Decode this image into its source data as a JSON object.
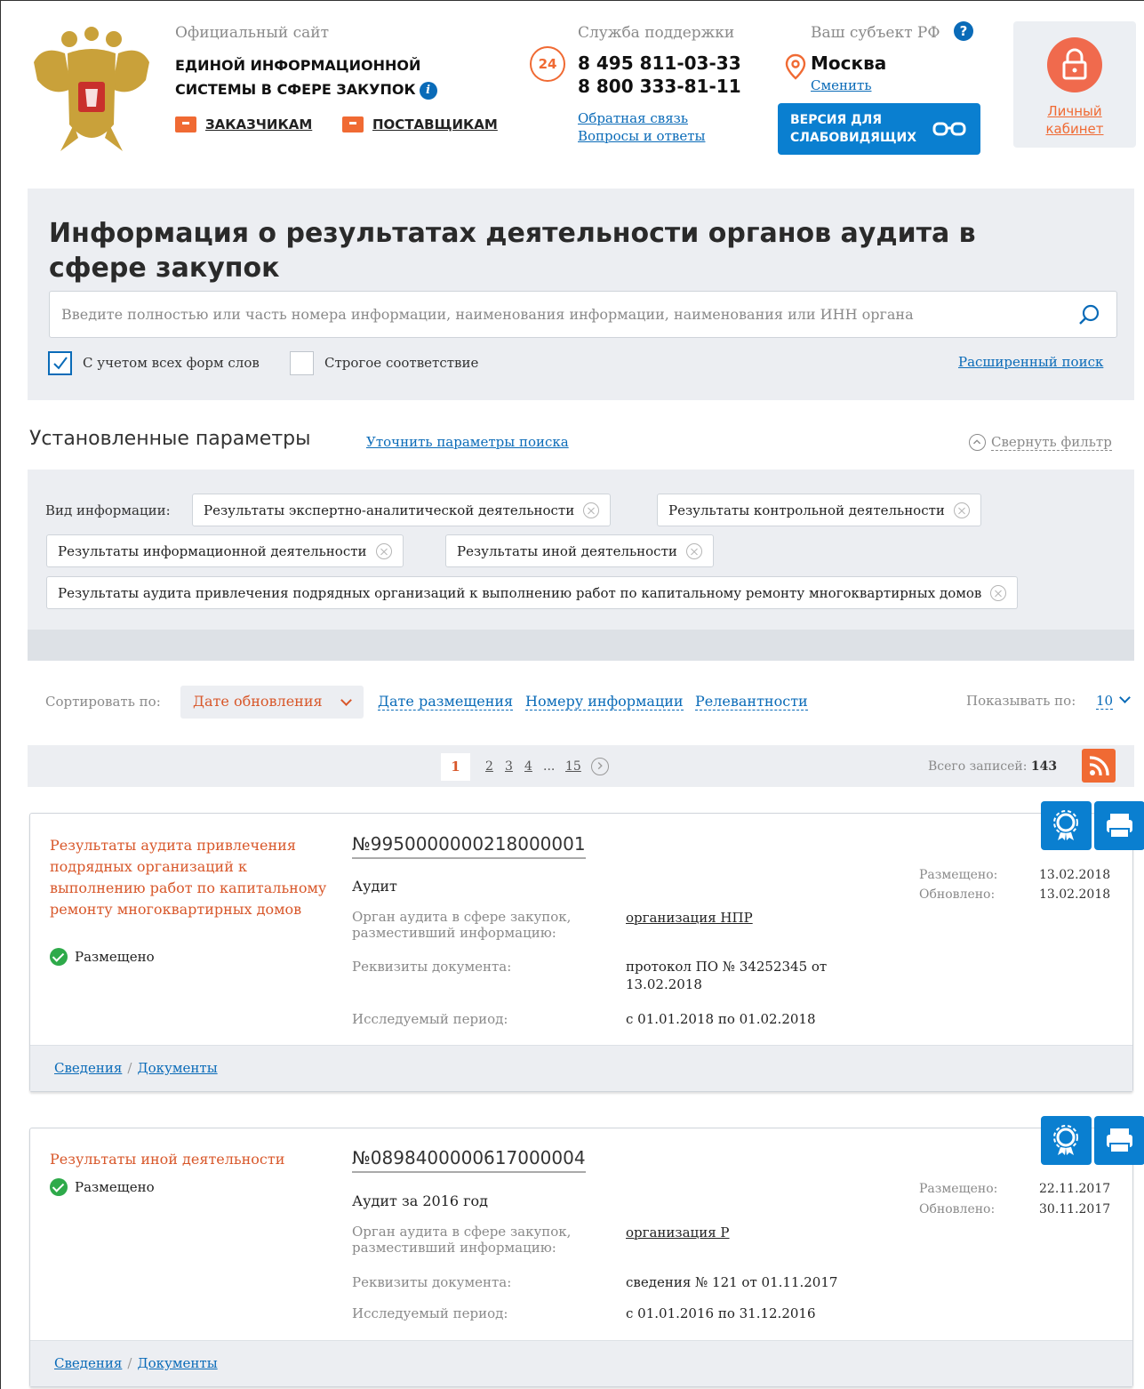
{
  "header": {
    "site_label": "Официальный сайт",
    "site_name_line1": "ЕДИНОЙ ИНФОРМАЦИОННОЙ",
    "site_name_line2": "СИСТЕМЫ В СФЕРЕ ЗАКУПОК",
    "info_icon": "i",
    "customers_link": "ЗАКАЗЧИКАМ",
    "suppliers_link": "ПОСТАВЩИКАМ",
    "support_label": "Служба поддержки",
    "support_badge": "24",
    "phone1": "8 495 811-03-33",
    "phone2": "8 800 333-81-11",
    "feedback_link": "Обратная связь",
    "faq_link": "Вопросы и ответы",
    "region_label": "Ваш субъект РФ",
    "help_icon": "?",
    "city": "Москва",
    "change_link": "Сменить",
    "vision_line1": "ВЕРСИЯ ДЛЯ",
    "vision_line2": "СЛАБОВИДЯЩИХ",
    "cabinet_line1": "Личный",
    "cabinet_line2": "кабинет"
  },
  "search": {
    "title": "Информация о результатах деятельности органов аудита в сфере закупок",
    "placeholder": "Введите полностью или часть номера информации, наименования информации, наименования или ИНН органа",
    "all_forms_label": "С учетом всех форм слов",
    "all_forms_checked": true,
    "strict_label": "Строгое соответствие",
    "strict_checked": false,
    "advanced_link": "Расширенный поиск"
  },
  "params": {
    "title": "Установленные параметры",
    "refine_link": "Уточнить параметры поиска",
    "collapse_link": "Свернуть фильтр",
    "filter_label": "Вид информации:",
    "chips": [
      "Результаты экспертно-аналитической деятельности",
      "Результаты контрольной деятельности",
      "Результаты информационной деятельности",
      "Результаты иной деятельности",
      "Результаты аудита привлечения подрядных организаций к выполнению работ по капитальному ремонту многоквартирных домов"
    ]
  },
  "sort": {
    "label": "Сортировать по:",
    "active": "Дате обновления",
    "options": [
      "Дате размещения",
      "Номеру информации",
      "Релевантности"
    ],
    "show_label": "Показывать по:",
    "show_value": "10"
  },
  "pager": {
    "current": "1",
    "pages": [
      "2",
      "3",
      "4",
      "...",
      "15"
    ],
    "total_label": "Всего записей:",
    "total_value": "143"
  },
  "labels": {
    "auditor": "Орган аудита в сфере закупок, разместивший информацию:",
    "requisites": "Реквизиты документа:",
    "period": "Исследуемый период:",
    "placed": "Размещено:",
    "updated": "Обновлено:",
    "details_link": "Сведения",
    "docs_link": "Документы",
    "separator": "/"
  },
  "records": [
    {
      "type": "Результаты аудита привлечения подрядных организаций к выполнению работ по капитальному ремонту многоквартирных домов",
      "status": "Размещено",
      "number": "№9950000000218000001",
      "subject": "Аудит",
      "auditor": "организация НПР",
      "requisites": "протокол ПО № 34252345 от 13.02.2018",
      "period": "с 01.01.2018 по 01.02.2018",
      "placed": "13.02.2018",
      "updated": "13.02.2018"
    },
    {
      "type": "Результаты иной деятельности",
      "status": "Размещено",
      "number": "№0898400000617000004",
      "subject": "Аудит за 2016 год",
      "auditor": "организация Р",
      "requisites": "сведения № 121 от 01.11.2017",
      "period": "с 01.01.2016 по 31.12.2016",
      "placed": "22.11.2017",
      "updated": "30.11.2017"
    }
  ],
  "colors": {
    "accent": "#f06a33",
    "link": "#0a6bb8",
    "button": "#0a7fd0",
    "panel": "#eceef2"
  },
  "icons": [
    "coat-of-arms-icon",
    "briefcase-icon",
    "box-icon",
    "pin-icon",
    "glasses-icon",
    "lock-icon",
    "search-icon",
    "chevron-down-icon",
    "rss-icon",
    "award-icon",
    "print-icon",
    "check-circle-icon"
  ]
}
